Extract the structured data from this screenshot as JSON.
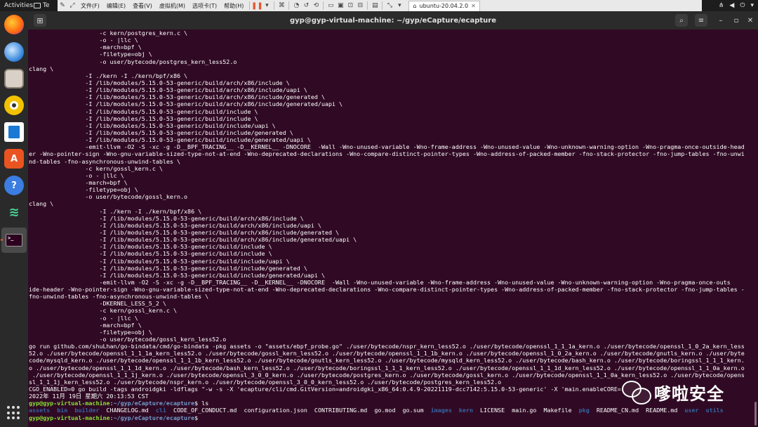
{
  "topbar": {
    "activities": "Activities",
    "terminal_app": "Te"
  },
  "vmware": {
    "menus": [
      "文件(F)",
      "编辑(E)",
      "查看(V)",
      "虚拟机(M)",
      "选项卡(T)",
      "帮助(H)"
    ],
    "tab_label": "ubuntu-20.04.2.0"
  },
  "window": {
    "title": "gyp@gyp-virtual-machine: ~/gyp/eCapture/ecapture"
  },
  "terminal": {
    "lines": [
      "                    -c kern/postgres_kern.c \\",
      "                    -o - |llc \\",
      "                    -march=bpf \\",
      "                    -filetype=obj \\",
      "                    -o user/bytecode/postgres_kern_less52.o",
      "clang \\",
      "                -I ./kern -I ./kern/bpf/x86 \\",
      "                -I /lib/modules/5.15.0-53-generic/build/arch/x86/include \\",
      "                -I /lib/modules/5.15.0-53-generic/build/arch/x86/include/uapi \\",
      "                -I /lib/modules/5.15.0-53-generic/build/arch/x86/include/generated \\",
      "                -I /lib/modules/5.15.0-53-generic/build/arch/x86/include/generated/uapi \\",
      "                -I /lib/modules/5.15.0-53-generic/build/include \\",
      "                -I /lib/modules/5.15.0-53-generic/build/include \\",
      "                -I /lib/modules/5.15.0-53-generic/build/include/uapi \\",
      "                -I /lib/modules/5.15.0-53-generic/build/include/generated \\",
      "                -I /lib/modules/5.15.0-53-generic/build/include/generated/uapi \\",
      "                -emit-llvm -O2 -S -xc -g -D__BPF_TRACING__ -D__KERNEL__ -DNOCORE  -Wall -Wno-unused-variable -Wno-frame-address -Wno-unused-value -Wno-unknown-warning-option -Wno-pragma-once-outside-head",
      "er -Wno-pointer-sign -Wno-gnu-variable-sized-type-not-at-end -Wno-deprecated-declarations -Wno-compare-distinct-pointer-types -Wno-address-of-packed-member -fno-stack-protector -fno-jump-tables -fno-unwi",
      "nd-tables -fno-asynchronous-unwind-tables \\",
      "                -c kern/gossl_kern.c \\",
      "                -o - |llc \\",
      "                -march=bpf \\",
      "                -filetype=obj \\",
      "                -o user/bytecode/gossl_kern.o",
      "clang \\",
      "                    -I ./kern -I ./kern/bpf/x86 \\",
      "                    -I /lib/modules/5.15.0-53-generic/build/arch/x86/include \\",
      "                    -I /lib/modules/5.15.0-53-generic/build/arch/x86/include/uapi \\",
      "                    -I /lib/modules/5.15.0-53-generic/build/arch/x86/include/generated \\",
      "                    -I /lib/modules/5.15.0-53-generic/build/arch/x86/include/generated/uapi \\",
      "                    -I /lib/modules/5.15.0-53-generic/build/include \\",
      "                    -I /lib/modules/5.15.0-53-generic/build/include \\",
      "                    -I /lib/modules/5.15.0-53-generic/build/include/uapi \\",
      "                    -I /lib/modules/5.15.0-53-generic/build/include/generated \\",
      "                    -I /lib/modules/5.15.0-53-generic/build/include/generated/uapi \\",
      "                    -emit-llvm -O2 -S -xc -g -D__BPF_TRACING__ -D__KERNEL__ -DNOCORE  -Wall -Wno-unused-variable -Wno-frame-address -Wno-unused-value -Wno-unknown-warning-option -Wno-pragma-once-outs",
      "ide-header -Wno-pointer-sign -Wno-gnu-variable-sized-type-not-at-end -Wno-deprecated-declarations -Wno-compare-distinct-pointer-types -Wno-address-of-packed-member -fno-stack-protector -fno-jump-tables -",
      "fno-unwind-tables -fno-asynchronous-unwind-tables \\",
      "                    -DKERNEL_LESS_5_2 \\",
      "                    -c kern/gossl_kern.c \\",
      "                    -o - |llc \\",
      "                    -march=bpf \\",
      "                    -filetype=obj \\",
      "                    -o user/bytecode/gossl_kern_less52.o",
      "go run github.com/shuLhan/go-bindata/cmd/go-bindata -pkg assets -o \"assets/ebpf_probe.go\" ./user/bytecode/nspr_kern_less52.o ./user/bytecode/openssl_1_1_1a_kern.o ./user/bytecode/openssl_1_0_2a_kern_less",
      "52.o ./user/bytecode/openssl_1_1_1a_kern_less52.o ./user/bytecode/gossl_kern_less52.o ./user/bytecode/openssl_1_1_1b_kern.o ./user/bytecode/openssl_1_0_2a_kern.o ./user/bytecode/gnutls_kern.o ./user/byte",
      "code/mysqld_kern.o ./user/bytecode/openssl_1_1_1b_kern_less52.o ./user/bytecode/gnutls_kern_less52.o ./user/bytecode/mysqld_kern_less52.o ./user/bytecode/bash_kern.o ./user/bytecode/boringssl_1_1_1_kern.",
      "o ./user/bytecode/openssl_1_1_1d_kern.o ./user/bytecode/bash_kern_less52.o ./user/bytecode/boringssl_1_1_1_kern_less52.o ./user/bytecode/openssl_1_1_1d_kern_less52.o ./user/bytecode/openssl_1_1_0a_kern.o",
      " ./user/bytecode/openssl_1_1_1j_kern.o ./user/bytecode/openssl_3_0_0_kern.o ./user/bytecode/postgres_kern.o ./user/bytecode/gossl_kern.o ./user/bytecode/openssl_1_1_0a_kern_less52.o ./user/bytecode/opens",
      "sl_1_1_1j_kern_less52.o ./user/bytecode/nspr_kern.o ./user/bytecode/openssl_3_0_0_kern_less52.o ./user/bytecode/postgres_kern_less52.o",
      "CGO_ENABLED=0 go build -tags androidgki -ldflags \"-w -s -X 'ecapture/cli/cmd.GitVersion=androidgki_x86_64:0.4.9-20221119-dcc7142:5.15.0-53-generic' -X 'main.enableCORE=",
      "2022年 11月 19日 星期六 20:13:53 CST"
    ],
    "prompt_user": "gyp@gyp-virtual-machine",
    "prompt_path": "~/gyp/eCapture/ecapture",
    "prompt_suffix": "$ ",
    "ls_command": "ls",
    "ls_entries": [
      {
        "name": "assets",
        "type": "dir"
      },
      {
        "name": "bin",
        "type": "dir"
      },
      {
        "name": "builder",
        "type": "dir"
      },
      {
        "name": "CHANGELOG.md",
        "type": "file"
      },
      {
        "name": "cli",
        "type": "dir"
      },
      {
        "name": "CODE_OF_CONDUCT.md",
        "type": "file"
      },
      {
        "name": "configuration.json",
        "type": "file"
      },
      {
        "name": "CONTRIBUTING.md",
        "type": "file"
      },
      {
        "name": "go.mod",
        "type": "file"
      },
      {
        "name": "go.sum",
        "type": "file"
      },
      {
        "name": "images",
        "type": "dir"
      },
      {
        "name": "kern",
        "type": "dir"
      },
      {
        "name": "LICENSE",
        "type": "file"
      },
      {
        "name": "main.go",
        "type": "file"
      },
      {
        "name": "Makefile",
        "type": "file"
      },
      {
        "name": "pkg",
        "type": "dir"
      },
      {
        "name": "README_CN.md",
        "type": "file"
      },
      {
        "name": "README.md",
        "type": "file"
      },
      {
        "name": "user",
        "type": "dir"
      },
      {
        "name": "utils",
        "type": "dir"
      }
    ]
  },
  "watermark": {
    "text": "嗲啦安全"
  },
  "colors": {
    "terminal_bg": "#300a24",
    "prompt_user": "#8ae234",
    "prompt_path": "#729fcf",
    "directory": "#3465a4"
  },
  "icons": {
    "dock": [
      "firefox-icon",
      "thunderbird-icon",
      "files-icon",
      "rhythmbox-icon",
      "writer-icon",
      "software-icon",
      "help-icon",
      "sublime-icon",
      "terminal-icon",
      "app-grid-icon"
    ]
  }
}
